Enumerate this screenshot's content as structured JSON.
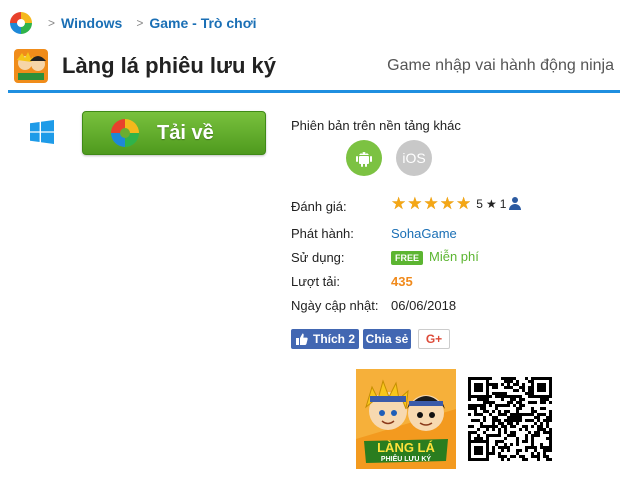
{
  "breadcrumb": {
    "items": [
      "Windows",
      "Game - Trò chơi"
    ],
    "separator": ">"
  },
  "app": {
    "title": "Làng lá phiêu lưu ký",
    "tagline": "Game nhập vai hành động ninja"
  },
  "download": {
    "label": "Tải về",
    "platform_icon": "windows-icon"
  },
  "platforms": {
    "heading": "Phiên bản trên nền tảng khác",
    "android_icon": "android-icon",
    "ios_label": "iOS"
  },
  "info": {
    "rating_label": "Đánh giá:",
    "rating_stars": 5,
    "rating_score": "5",
    "rating_count": "1",
    "publisher_label": "Phát hành:",
    "publisher": "SohaGame",
    "license_label": "Sử dụng:",
    "license_badge": "FREE",
    "license": "Miễn phí",
    "downloads_label": "Lượt tải:",
    "downloads": "435",
    "updated_label": "Ngày cập nhật:",
    "updated": "06/06/2018"
  },
  "social": {
    "like_label": "Thích 2",
    "share_label": "Chia sẻ",
    "gplus_label": "G+"
  },
  "thumbnail": {
    "logo_line1": "LÀNG LÁ",
    "logo_line2": "PHIÊU LƯU KÝ"
  },
  "colors": {
    "accent": "#1f8fe0",
    "download_green": "#5ea528",
    "link_blue": "#1a6fb5",
    "star": "#f4a716",
    "downloads_orange": "#f08a1c",
    "facebook": "#4267b2"
  }
}
